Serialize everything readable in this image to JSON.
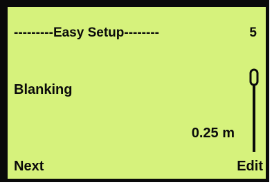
{
  "screen": {
    "header_title": "---------Easy Setup--------",
    "screen_number": "5",
    "parameter_label": "Blanking",
    "parameter_value": "0.25 m",
    "scroll_position": 0.0
  },
  "softkeys": {
    "left_label": "Next",
    "right_label": "Edit"
  },
  "colors": {
    "lcd_background": "#d6f27c",
    "lcd_text": "#0a0a0a",
    "bezel": "#0a0a0a"
  }
}
